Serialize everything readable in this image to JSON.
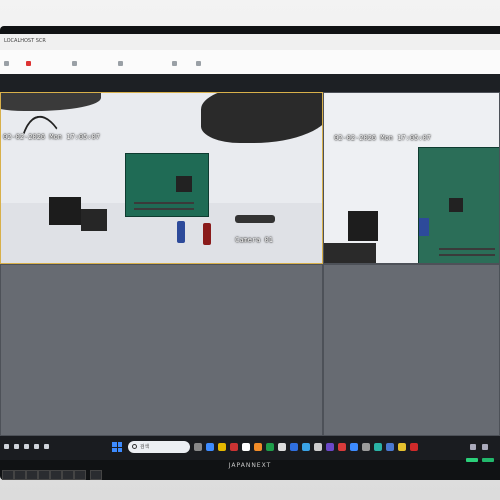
{
  "window": {
    "tab_title": "LOCALHOST SCR",
    "toolbar_items": [
      "",
      "",
      "",
      "",
      "",
      ""
    ]
  },
  "feeds": [
    {
      "timestamp": "02-02-2026 Mon 17:05:07",
      "camera_label": "Camera 01",
      "selected": true
    },
    {
      "timestamp": "02-02-2026 Mon 17:05:07",
      "camera_label": "",
      "selected": false
    }
  ],
  "taskbar": {
    "search_placeholder": "검색"
  },
  "monitor": {
    "brand": "JAPANNEXT"
  },
  "colors": {
    "osd_text": "#ffffff",
    "selected_border": "#d8b04a",
    "taskbar": "#1a1c20",
    "windows_accent": "#3d8bff"
  }
}
